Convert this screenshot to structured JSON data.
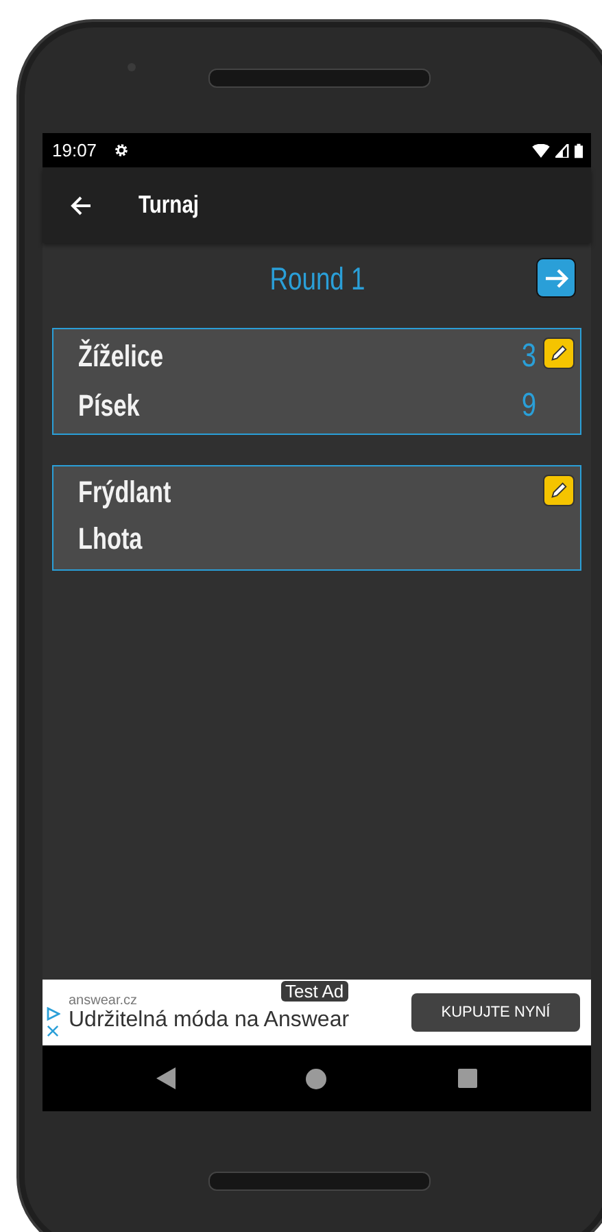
{
  "status_bar": {
    "time": "19:07"
  },
  "app_bar": {
    "title": "Turnaj"
  },
  "round": {
    "title": "Round 1"
  },
  "matches": [
    {
      "home": "Žíželice",
      "away": "Písek",
      "home_score": "3",
      "away_score": "9"
    },
    {
      "home": "Frýdlant",
      "away": "Lhota"
    }
  ],
  "ad": {
    "badge": "Test Ad",
    "domain": "answear.cz",
    "headline": "Udržitelná móda na Answear",
    "button": "KUPUJTE NYNÍ"
  }
}
